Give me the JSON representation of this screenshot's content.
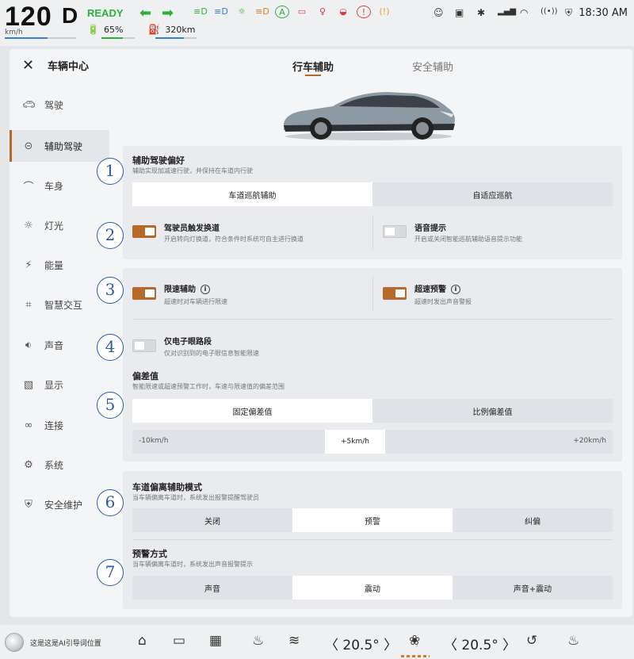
{
  "status": {
    "speed": "120",
    "speed_unit": "km/h",
    "gear": "D",
    "ready": "READY",
    "battery_pct": "65%",
    "range": "320km",
    "time": "18:30 AM",
    "colors": {
      "green": "#2fae3d",
      "accent": "#b56a2a"
    }
  },
  "sidebar": {
    "title": "车辆中心",
    "items": [
      {
        "label": "驾驶",
        "icon": "car-icon"
      },
      {
        "label": "辅助驾驶",
        "icon": "steering-wheel-icon"
      },
      {
        "label": "车身",
        "icon": "car-body-icon"
      },
      {
        "label": "灯光",
        "icon": "sun-icon"
      },
      {
        "label": "能量",
        "icon": "lightning-icon"
      },
      {
        "label": "智慧交互",
        "icon": "interaction-icon"
      },
      {
        "label": "声音",
        "icon": "speaker-icon"
      },
      {
        "label": "显示",
        "icon": "display-icon"
      },
      {
        "label": "连接",
        "icon": "link-icon"
      },
      {
        "label": "系统",
        "icon": "gear-icon"
      },
      {
        "label": "安全维护",
        "icon": "shield-icon"
      }
    ]
  },
  "tabs": {
    "driving_assist": "行车辅助",
    "safety_assist": "安全辅助"
  },
  "pref": {
    "title": "辅助驾驶偏好",
    "subtitle": "辅助实现加减速行驶，并保持在车道内行驶",
    "options": [
      "车道巡航辅助",
      "自适应巡航"
    ]
  },
  "lane_change": {
    "title": "驾驶员触发换道",
    "subtitle": "开启转向灯换道，符合条件时系统可自主进行换道"
  },
  "voice": {
    "title": "语音提示",
    "subtitle": "开启或关闭智能巡航辅助语音提示功能"
  },
  "speed_limit": {
    "title": "限速辅助",
    "subtitle": "超速时对车辆进行限速"
  },
  "overspeed": {
    "title": "超速预警",
    "subtitle": "超速时发出声音警报"
  },
  "eye_only": {
    "title": "仅电子眼路段",
    "subtitle": "仅对识别到的电子眼信息智能限速"
  },
  "deviation": {
    "title": "偏差值",
    "subtitle": "智能限速或超速预警工作时，车速与限速值的偏差范围",
    "options": [
      "固定偏差值",
      "比例偏差值"
    ],
    "slider_min": "-10km/h",
    "slider_value": "+5km/h",
    "slider_max": "+20km/h",
    "slider_fraction": 0.5
  },
  "lane_departure": {
    "title": "车道偏离辅助模式",
    "subtitle": "当车辆偏离车道时，系统发出报警提醒驾驶员",
    "options": [
      "关闭",
      "预警",
      "纠偏"
    ]
  },
  "warning_mode": {
    "title": "预警方式",
    "subtitle": "当车辆偏离车道时，系统发出声音报警提示",
    "options": [
      "声音",
      "震动",
      "声音+震动"
    ]
  },
  "markers": [
    "1",
    "2",
    "3",
    "4",
    "5",
    "6",
    "7"
  ],
  "dock": {
    "ai_prompt": "这是这是AI引导词位置",
    "temp_left": "〈 20.5° 〉",
    "temp_right": "〈 20.5° 〉"
  }
}
